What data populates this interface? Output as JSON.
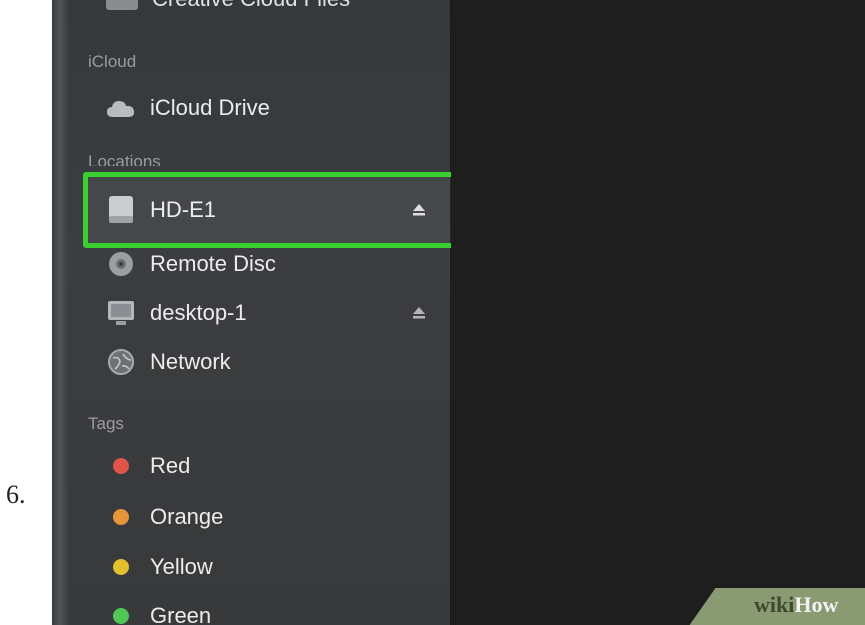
{
  "step_number": "6.",
  "sidebar": {
    "top_partial_item": "Creative Cloud Files",
    "sections": [
      {
        "header": "iCloud",
        "items": [
          {
            "label": "iCloud Drive",
            "icon": "cloud-icon"
          }
        ]
      },
      {
        "header": "Locations",
        "items": [
          {
            "label": "HD-E1",
            "icon": "external-drive-icon",
            "eject": true,
            "highlighted": true
          },
          {
            "label": "Remote Disc",
            "icon": "disc-icon"
          },
          {
            "label": "desktop-1",
            "icon": "computer-icon",
            "eject": true
          },
          {
            "label": "Network",
            "icon": "network-globe-icon"
          }
        ]
      },
      {
        "header": "Tags",
        "items": [
          {
            "label": "Red",
            "icon": "tag-dot-icon",
            "color": "#e0544a"
          },
          {
            "label": "Orange",
            "icon": "tag-dot-icon",
            "color": "#e8953a"
          },
          {
            "label": "Yellow",
            "icon": "tag-dot-icon",
            "color": "#e2c12f"
          },
          {
            "label": "Green",
            "icon": "tag-dot-icon",
            "color": "#4fc655"
          }
        ]
      }
    ]
  },
  "highlight_color": "#38d130",
  "watermark": {
    "part1": "wiki",
    "part2": "How"
  }
}
